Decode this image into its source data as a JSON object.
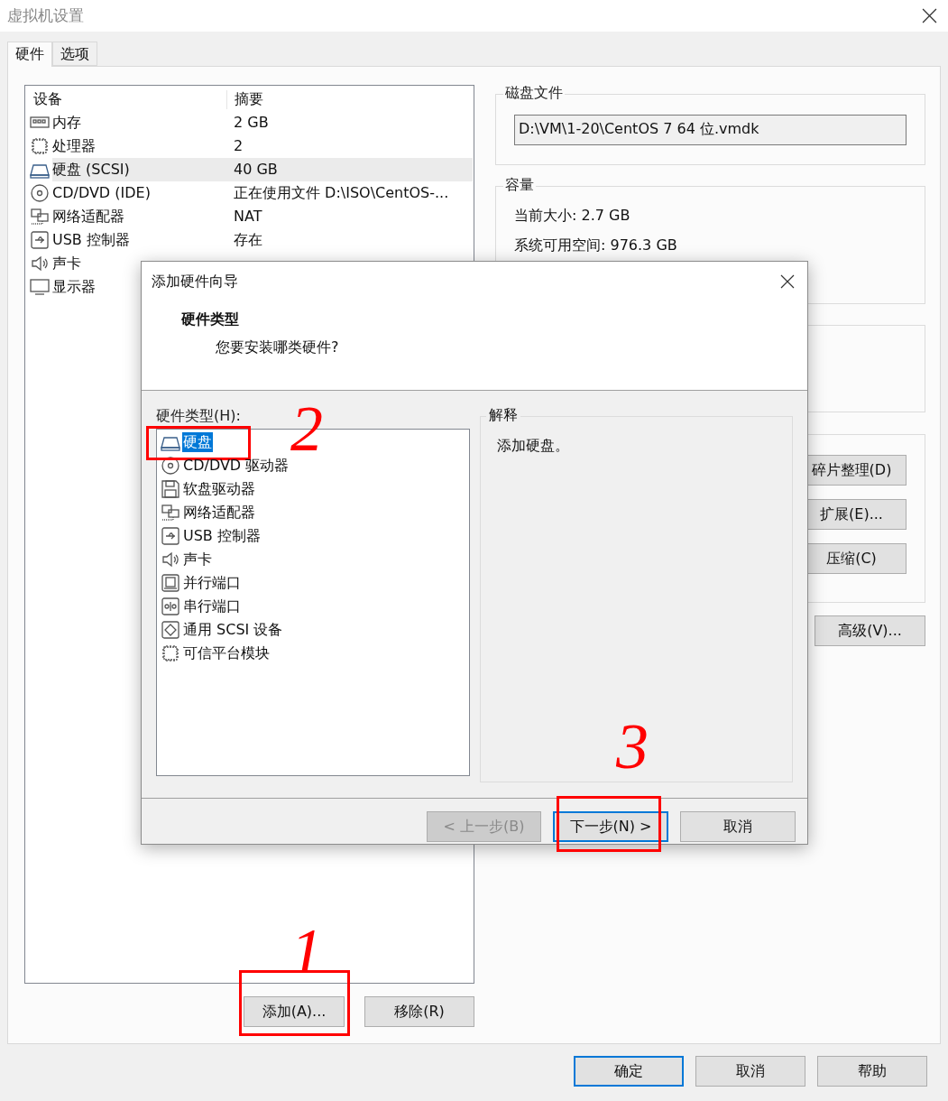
{
  "window": {
    "title": "虚拟机设置"
  },
  "tabs": [
    {
      "label": "硬件",
      "selected": true
    },
    {
      "label": "选项",
      "selected": false
    }
  ],
  "device_table": {
    "columns": [
      "设备",
      "摘要"
    ],
    "rows": [
      {
        "kind": "memory",
        "device": "内存",
        "summary": "2 GB",
        "selected": false
      },
      {
        "kind": "cpu",
        "device": "处理器",
        "summary": "2",
        "selected": false
      },
      {
        "kind": "disk",
        "device": "硬盘 (SCSI)",
        "summary": "40 GB",
        "selected": true
      },
      {
        "kind": "cd",
        "device": "CD/DVD (IDE)",
        "summary": "正在使用文件 D:\\ISO\\CentOS-...",
        "selected": false
      },
      {
        "kind": "network",
        "device": "网络适配器",
        "summary": "NAT",
        "selected": false
      },
      {
        "kind": "usb",
        "device": "USB 控制器",
        "summary": "存在",
        "selected": false
      },
      {
        "kind": "sound",
        "device": "声卡",
        "selected": false
      },
      {
        "kind": "display",
        "device": "显示器",
        "selected": false
      }
    ]
  },
  "device_buttons": [
    {
      "label": "添加(A)...",
      "annotation": "1"
    },
    {
      "label": "移除(R)"
    }
  ],
  "disk_file": {
    "title": "磁盘文件",
    "value": "D:\\VM\\1-20\\CentOS 7 64 位.vmdk"
  },
  "capacity": {
    "title": "容量",
    "lines": [
      {
        "label": "当前大小:",
        "value": "2.7 GB"
      },
      {
        "label": "系统可用空间:",
        "value": "976.3 GB"
      }
    ]
  },
  "utility_buttons": [
    "碎片整理(D)",
    "扩展(E)...",
    "压缩(C)"
  ],
  "advanced_button": "高级(V)...",
  "footer_buttons": [
    {
      "label": "确定",
      "default": true
    },
    {
      "label": "取消",
      "default": false
    },
    {
      "label": "帮助",
      "default": false
    }
  ],
  "dialog": {
    "title": "添加硬件向导",
    "heading": "硬件类型",
    "subheading": "您要安装哪类硬件?",
    "list_label": "硬件类型(H):",
    "items": [
      {
        "kind": "disk",
        "label": "硬盘",
        "selected": true,
        "annotation": "2"
      },
      {
        "kind": "cd",
        "label": "CD/DVD 驱动器",
        "selected": false
      },
      {
        "kind": "floppy",
        "label": "软盘驱动器",
        "selected": false
      },
      {
        "kind": "network",
        "label": "网络适配器",
        "selected": false
      },
      {
        "kind": "usb",
        "label": "USB 控制器",
        "selected": false
      },
      {
        "kind": "sound",
        "label": "声卡",
        "selected": false
      },
      {
        "kind": "parallel",
        "label": "并行端口",
        "selected": false
      },
      {
        "kind": "serial",
        "label": "串行端口",
        "selected": false
      },
      {
        "kind": "scsi",
        "label": "通用 SCSI 设备",
        "selected": false
      },
      {
        "kind": "tpm",
        "label": "可信平台模块",
        "selected": false
      }
    ],
    "explanation": {
      "title": "解释",
      "text": "添加硬盘。"
    },
    "buttons": [
      {
        "label": "< 上一步(B)",
        "disabled": true,
        "default": false
      },
      {
        "label": "下一步(N) >",
        "disabled": false,
        "default": true,
        "annotation": "3"
      },
      {
        "label": "取消",
        "disabled": false,
        "default": false
      }
    ]
  }
}
